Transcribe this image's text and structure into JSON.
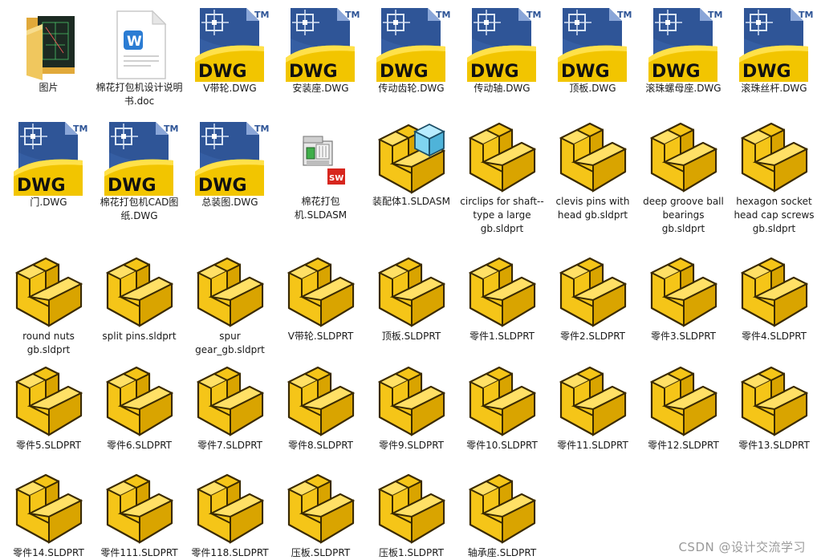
{
  "window": {
    "view": "large-icons",
    "watermark": "CSDN @设计交流学习"
  },
  "files": [
    {
      "name": "图片",
      "icon": "folder-icon"
    },
    {
      "name": "棉花打包机设计说明书.doc",
      "icon": "word-document-icon"
    },
    {
      "name": "V带轮.DWG",
      "icon": "dwg-file-icon"
    },
    {
      "name": "安装座.DWG",
      "icon": "dwg-file-icon"
    },
    {
      "name": "传动齿轮.DWG",
      "icon": "dwg-file-icon"
    },
    {
      "name": "传动轴.DWG",
      "icon": "dwg-file-icon"
    },
    {
      "name": "顶板.DWG",
      "icon": "dwg-file-icon"
    },
    {
      "name": "滚珠螺母座.DWG",
      "icon": "dwg-file-icon"
    },
    {
      "name": "滚珠丝杆.DWG",
      "icon": "dwg-file-icon"
    },
    {
      "name": "门.DWG",
      "icon": "dwg-file-icon"
    },
    {
      "name": "棉花打包机CAD图纸.DWG",
      "icon": "dwg-file-icon"
    },
    {
      "name": "总装图.DWG",
      "icon": "dwg-file-icon"
    },
    {
      "name": "棉花打包机.SLDASM",
      "icon": "solidworks-assembly-icon"
    },
    {
      "name": "装配体1.SLDASM",
      "icon": "assembly-cube-icon"
    },
    {
      "name": "circlips for shaft--type a large gb.sldprt",
      "icon": "part-icon"
    },
    {
      "name": "clevis pins with head gb.sldprt",
      "icon": "part-icon"
    },
    {
      "name": "deep groove ball bearings gb.sldprt",
      "icon": "part-icon"
    },
    {
      "name": "hexagon socket head cap screws gb.sldprt",
      "icon": "part-icon"
    },
    {
      "name": "round nuts gb.sldprt",
      "icon": "part-icon"
    },
    {
      "name": "split pins.sldprt",
      "icon": "part-icon"
    },
    {
      "name": "spur gear_gb.sldprt",
      "icon": "part-icon"
    },
    {
      "name": "V带轮.SLDPRT",
      "icon": "part-icon"
    },
    {
      "name": "顶板.SLDPRT",
      "icon": "part-icon"
    },
    {
      "name": "零件1.SLDPRT",
      "icon": "part-icon"
    },
    {
      "name": "零件2.SLDPRT",
      "icon": "part-icon"
    },
    {
      "name": "零件3.SLDPRT",
      "icon": "part-icon"
    },
    {
      "name": "零件4.SLDPRT",
      "icon": "part-icon"
    },
    {
      "name": "零件5.SLDPRT",
      "icon": "part-icon"
    },
    {
      "name": "零件6.SLDPRT",
      "icon": "part-icon"
    },
    {
      "name": "零件7.SLDPRT",
      "icon": "part-icon"
    },
    {
      "name": "零件8.SLDPRT",
      "icon": "part-icon"
    },
    {
      "name": "零件9.SLDPRT",
      "icon": "part-icon"
    },
    {
      "name": "零件10.SLDPRT",
      "icon": "part-icon"
    },
    {
      "name": "零件11.SLDPRT",
      "icon": "part-icon"
    },
    {
      "name": "零件12.SLDPRT",
      "icon": "part-icon"
    },
    {
      "name": "零件13.SLDPRT",
      "icon": "part-icon"
    },
    {
      "name": "零件14.SLDPRT",
      "icon": "part-icon"
    },
    {
      "name": "零件111.SLDPRT",
      "icon": "part-icon"
    },
    {
      "name": "零件118.SLDPRT",
      "icon": "part-icon"
    },
    {
      "name": "压板.SLDPRT",
      "icon": "part-icon"
    },
    {
      "name": "压板1.SLDPRT",
      "icon": "part-icon"
    },
    {
      "name": "轴承座.SLDPRT",
      "icon": "part-icon"
    }
  ],
  "icon_text": {
    "dwg_badge": "DWG",
    "dwg_tm": "TM",
    "word_letter": "W",
    "sw_badge": "SW"
  },
  "colors": {
    "part_yellow": "#f5c518",
    "part_yellow_dark": "#d9a400",
    "part_outline": "#3a2a00",
    "dwg_blue": "#2f5597",
    "dwg_yellow": "#f2c500",
    "folder_yellow": "#f0c75e",
    "word_blue": "#2b7cd3",
    "cube_cyan": "#7fd4f0"
  }
}
